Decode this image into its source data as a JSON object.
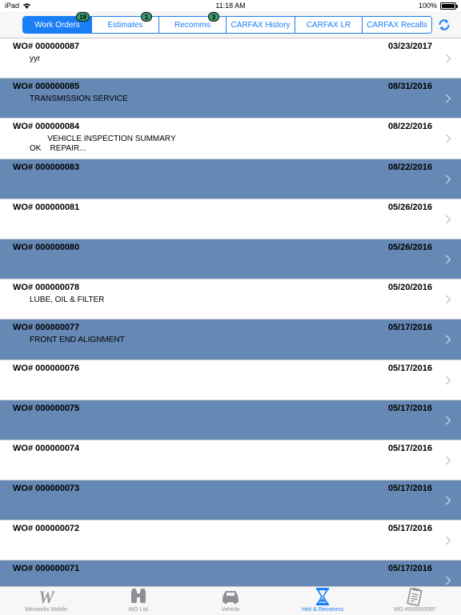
{
  "status_bar": {
    "carrier": "iPad",
    "time": "11:18 AM",
    "battery": "100%"
  },
  "segments": [
    {
      "label": "Work Orders",
      "badge": "19",
      "active": true
    },
    {
      "label": "Estimates",
      "badge": "1",
      "active": false
    },
    {
      "label": "Recomms",
      "badge": "3",
      "active": false
    },
    {
      "label": "CARFAX History",
      "badge": "",
      "active": false
    },
    {
      "label": "CARFAX LR",
      "badge": "",
      "active": false
    },
    {
      "label": "CARFAX Recalls",
      "badge": "",
      "active": false
    }
  ],
  "work_orders": [
    {
      "wo": "WO# 000000087",
      "date": "03/23/2017",
      "desc": "yyr"
    },
    {
      "wo": "WO# 000000085",
      "date": "08/31/2016",
      "desc": "TRANSMISSION SERVICE"
    },
    {
      "wo": "WO# 000000084",
      "date": "08/22/2016",
      "desc": "        VEHICLE INSPECTION SUMMARY\nOK    REPAIR..."
    },
    {
      "wo": "WO# 000000083",
      "date": "08/22/2016",
      "desc": ""
    },
    {
      "wo": "WO# 000000081",
      "date": "05/26/2016",
      "desc": ""
    },
    {
      "wo": "WO# 000000080",
      "date": "05/26/2016",
      "desc": ""
    },
    {
      "wo": "WO# 000000078",
      "date": "05/20/2016",
      "desc": "LUBE, OIL & FILTER"
    },
    {
      "wo": "WO# 000000077",
      "date": "05/17/2016",
      "desc": "FRONT END ALIGNMENT"
    },
    {
      "wo": "WO# 000000076",
      "date": "05/17/2016",
      "desc": ""
    },
    {
      "wo": "WO# 000000075",
      "date": "05/17/2016",
      "desc": ""
    },
    {
      "wo": "WO# 000000074",
      "date": "05/17/2016",
      "desc": ""
    },
    {
      "wo": "WO# 000000073",
      "date": "05/17/2016",
      "desc": ""
    },
    {
      "wo": "WO# 000000072",
      "date": "05/17/2016",
      "desc": ""
    },
    {
      "wo": "WO# 000000071",
      "date": "05/17/2016",
      "desc": ""
    }
  ],
  "tabs": [
    {
      "label": "Winworks Mobile",
      "icon": "winworks-logo-icon",
      "active": false
    },
    {
      "label": "WO List",
      "icon": "binoculars-icon",
      "active": false
    },
    {
      "label": "Vehicle",
      "icon": "car-icon",
      "active": false
    },
    {
      "label": "Hist & Recomms",
      "icon": "hourglass-icon",
      "active": true
    },
    {
      "label": "WO #000000087",
      "icon": "clipboard-icon",
      "active": false
    }
  ],
  "colors": {
    "accent": "#1a7ef5",
    "alt_row": "#6588b4",
    "badge": "#3c9c6e"
  }
}
